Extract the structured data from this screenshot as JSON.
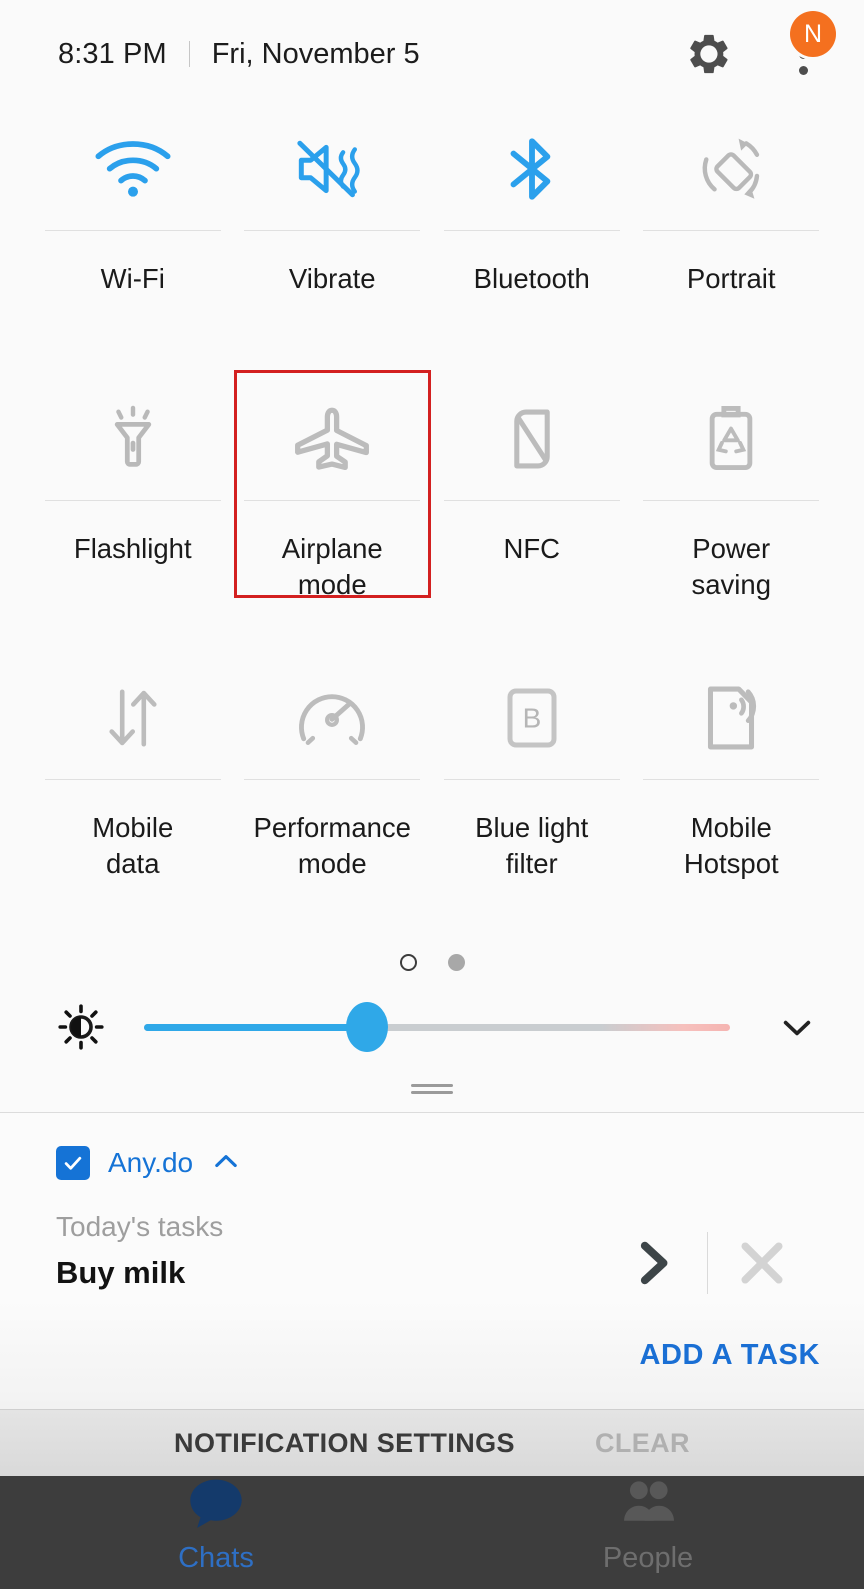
{
  "statusbar": {
    "time": "8:31 PM",
    "date": "Fri, November 5",
    "settings_icon": "gear-icon",
    "menu_icon": "kebab-menu-icon",
    "badge_label": "N",
    "badge_color": "#f4701f"
  },
  "quick_settings": {
    "tiles": [
      {
        "label": "Wi-Fi",
        "icon": "wifi-icon",
        "active": true
      },
      {
        "label": "Vibrate",
        "icon": "vibrate-icon",
        "active": true
      },
      {
        "label": "Bluetooth",
        "icon": "bluetooth-icon",
        "active": true
      },
      {
        "label": "Portrait",
        "icon": "screen-rotation-icon",
        "active": false
      },
      {
        "label": "Flashlight",
        "icon": "flashlight-icon",
        "active": false
      },
      {
        "label": "Airplane\nmode",
        "icon": "airplane-icon",
        "active": false,
        "highlighted": true
      },
      {
        "label": "NFC",
        "icon": "nfc-icon",
        "active": false
      },
      {
        "label": "Power\nsaving",
        "icon": "power-saving-icon",
        "active": false
      },
      {
        "label": "Mobile\ndata",
        "icon": "mobile-data-icon",
        "active": false
      },
      {
        "label": "Performance\nmode",
        "icon": "performance-icon",
        "active": false
      },
      {
        "label": "Blue light\nfilter",
        "icon": "blue-light-filter-icon",
        "active": false
      },
      {
        "label": "Mobile\nHotspot",
        "icon": "mobile-hotspot-icon",
        "active": false
      }
    ],
    "active_color": "#2ba0ec",
    "inactive_color": "#b9b9b9",
    "highlight_color": "#d32020",
    "pages": {
      "count": 2,
      "current": 1
    }
  },
  "brightness": {
    "icon": "brightness-icon",
    "value_percent": 38,
    "expand_icon": "chevron-down-icon",
    "fill_color": "#2fa8e8"
  },
  "drag_handle": "shade-drag-handle",
  "notification": {
    "app_name": "Any.do",
    "app_icon": "checkbox-checked-icon",
    "collapse_icon": "chevron-up-icon",
    "subtitle": "Today's tasks",
    "title": "Buy milk",
    "action_complete_icon": "chevron-right-icon",
    "action_dismiss_icon": "close-x-icon",
    "add_task_label": "ADD A TASK",
    "accent_color": "#1573d6"
  },
  "notification_toolbar": {
    "settings_label": "NOTIFICATION SETTINGS",
    "clear_label": "CLEAR"
  },
  "app_behind": {
    "tabs": [
      {
        "label": "Chats",
        "icon": "chat-bubble-icon",
        "active": true
      },
      {
        "label": "People",
        "icon": "people-icon",
        "active": false
      }
    ]
  }
}
